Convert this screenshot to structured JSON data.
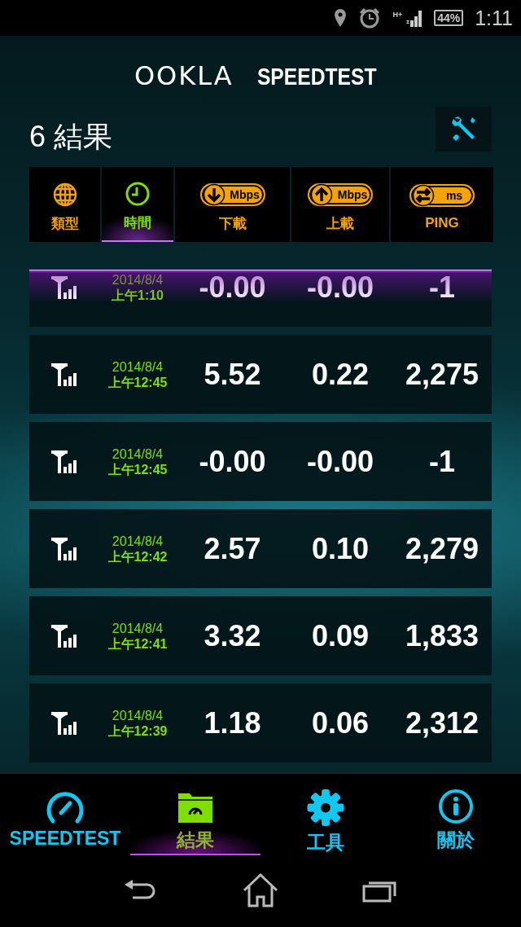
{
  "status_bar": {
    "network": "H+",
    "battery": "44%",
    "time": "1:11"
  },
  "logo": {
    "brand": "OOKLA",
    "product": "SPEEDTEST"
  },
  "title": "6 結果",
  "sort_tabs": [
    {
      "kind": "type",
      "label": "類型",
      "selected": false
    },
    {
      "kind": "time",
      "label": "時間",
      "selected": true
    },
    {
      "kind": "download",
      "label": "下載",
      "unit": "Mbps",
      "selected": false
    },
    {
      "kind": "upload",
      "label": "上載",
      "unit": "Mbps",
      "selected": false
    },
    {
      "kind": "ping",
      "label": "PING",
      "unit": "ms",
      "selected": false
    }
  ],
  "results": [
    {
      "date": "2014/8/4",
      "time": "上午1:10",
      "download": "-0.00",
      "upload": "-0.00",
      "ping": "-1"
    },
    {
      "date": "2014/8/4",
      "time": "上午12:45",
      "download": "5.52",
      "upload": "0.22",
      "ping": "2,275"
    },
    {
      "date": "2014/8/4",
      "time": "上午12:45",
      "download": "-0.00",
      "upload": "-0.00",
      "ping": "-1"
    },
    {
      "date": "2014/8/4",
      "time": "上午12:42",
      "download": "2.57",
      "upload": "0.10",
      "ping": "2,279"
    },
    {
      "date": "2014/8/4",
      "time": "上午12:41",
      "download": "3.32",
      "upload": "0.09",
      "ping": "1,833"
    },
    {
      "date": "2014/8/4",
      "time": "上午12:39",
      "download": "1.18",
      "upload": "0.06",
      "ping": "2,312"
    }
  ],
  "bottom_nav": [
    {
      "kind": "speedtest",
      "label": "SPEEDTEST",
      "selected": false
    },
    {
      "kind": "results",
      "label": "結果",
      "selected": true
    },
    {
      "kind": "tools",
      "label": "工具",
      "selected": false
    },
    {
      "kind": "about",
      "label": "關於",
      "selected": false
    }
  ]
}
